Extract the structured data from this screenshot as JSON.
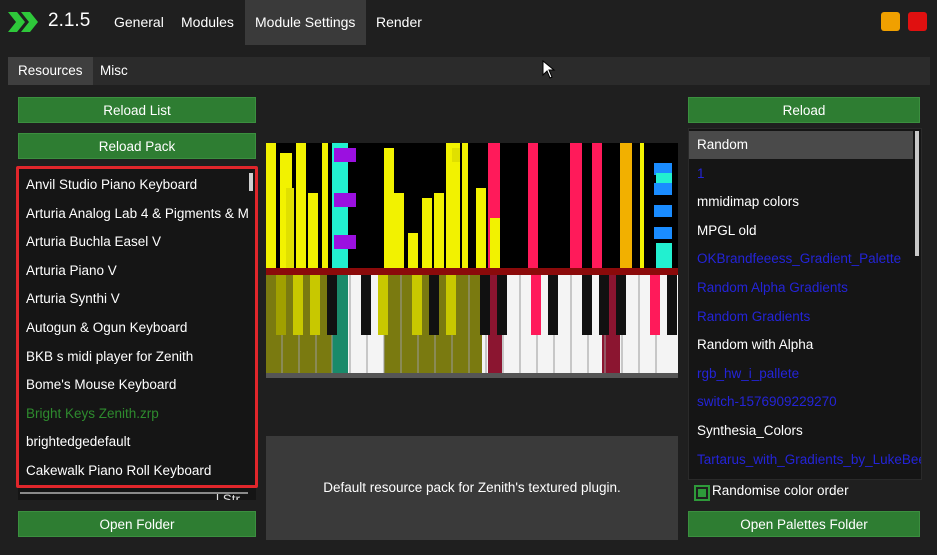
{
  "header": {
    "version": "2.1.5",
    "tabs": [
      {
        "label": "General"
      },
      {
        "label": "Modules"
      },
      {
        "label": "Module Settings"
      },
      {
        "label": "Render"
      }
    ],
    "active_tab": "Module Settings",
    "window_buttons": [
      {
        "name": "minimize",
        "color": "#f0a000"
      },
      {
        "name": "close",
        "color": "#e01010"
      }
    ]
  },
  "subtabs": [
    {
      "label": "Resources"
    },
    {
      "label": "Misc"
    }
  ],
  "left": {
    "reload_list": "Reload List",
    "reload_pack": "Reload Pack",
    "items": [
      {
        "label": "Anvil Studio Piano Keyboard",
        "color": "#ffffff"
      },
      {
        "label": "Arturia Analog Lab 4 & Pigments & M",
        "color": "#ffffff"
      },
      {
        "label": "Arturia Buchla Easel V",
        "color": "#ffffff"
      },
      {
        "label": "Arturia Piano V",
        "color": "#ffffff"
      },
      {
        "label": "Arturia Synthi V",
        "color": "#ffffff"
      },
      {
        "label": "Autogun & Ogun Keyboard",
        "color": "#ffffff"
      },
      {
        "label": "BKB s midi player for Zenith",
        "color": "#ffffff"
      },
      {
        "label": "Bome's Mouse Keyboard",
        "color": "#ffffff"
      },
      {
        "label": "Bright Keys Zenith.zrp",
        "color": "#2e8b2e"
      },
      {
        "label": "brightedgedefault",
        "color": "#ffffff"
      },
      {
        "label": "Cakewalk Piano Roll Keyboard",
        "color": "#ffffff"
      }
    ],
    "partial_item": "l Str",
    "open_folder": "Open Folder"
  },
  "center": {
    "description": "Default resource pack for Zenith's textured plugin."
  },
  "right": {
    "reload": "Reload",
    "items": [
      {
        "label": "Random",
        "color": "#ffffff",
        "selected": true
      },
      {
        "label": "1",
        "color": "#2424d8"
      },
      {
        "label": "mmidimap colors",
        "color": "#ffffff"
      },
      {
        "label": "MPGL old",
        "color": "#ffffff"
      },
      {
        "label": "OKBrandfeeess_Gradient_Palette",
        "color": "#2424d8"
      },
      {
        "label": "Random Alpha Gradients",
        "color": "#2424d8"
      },
      {
        "label": "Random Gradients",
        "color": "#2424d8"
      },
      {
        "label": "Random with Alpha",
        "color": "#ffffff"
      },
      {
        "label": "rgb_hw_i_pallete",
        "color": "#2424d8"
      },
      {
        "label": "switch-1576909229270",
        "color": "#2424d8"
      },
      {
        "label": "Synthesia_Colors",
        "color": "#ffffff"
      },
      {
        "label": "Tartarus_with_Gradients_by_LukeBee",
        "color": "#2424d8"
      }
    ],
    "randomise_label": "Randomise color order",
    "randomise_checked": true,
    "open_palettes": "Open Palettes Folder"
  },
  "colors": {
    "accent_green": "#2e7d32",
    "highlight_red": "#e0262b"
  }
}
